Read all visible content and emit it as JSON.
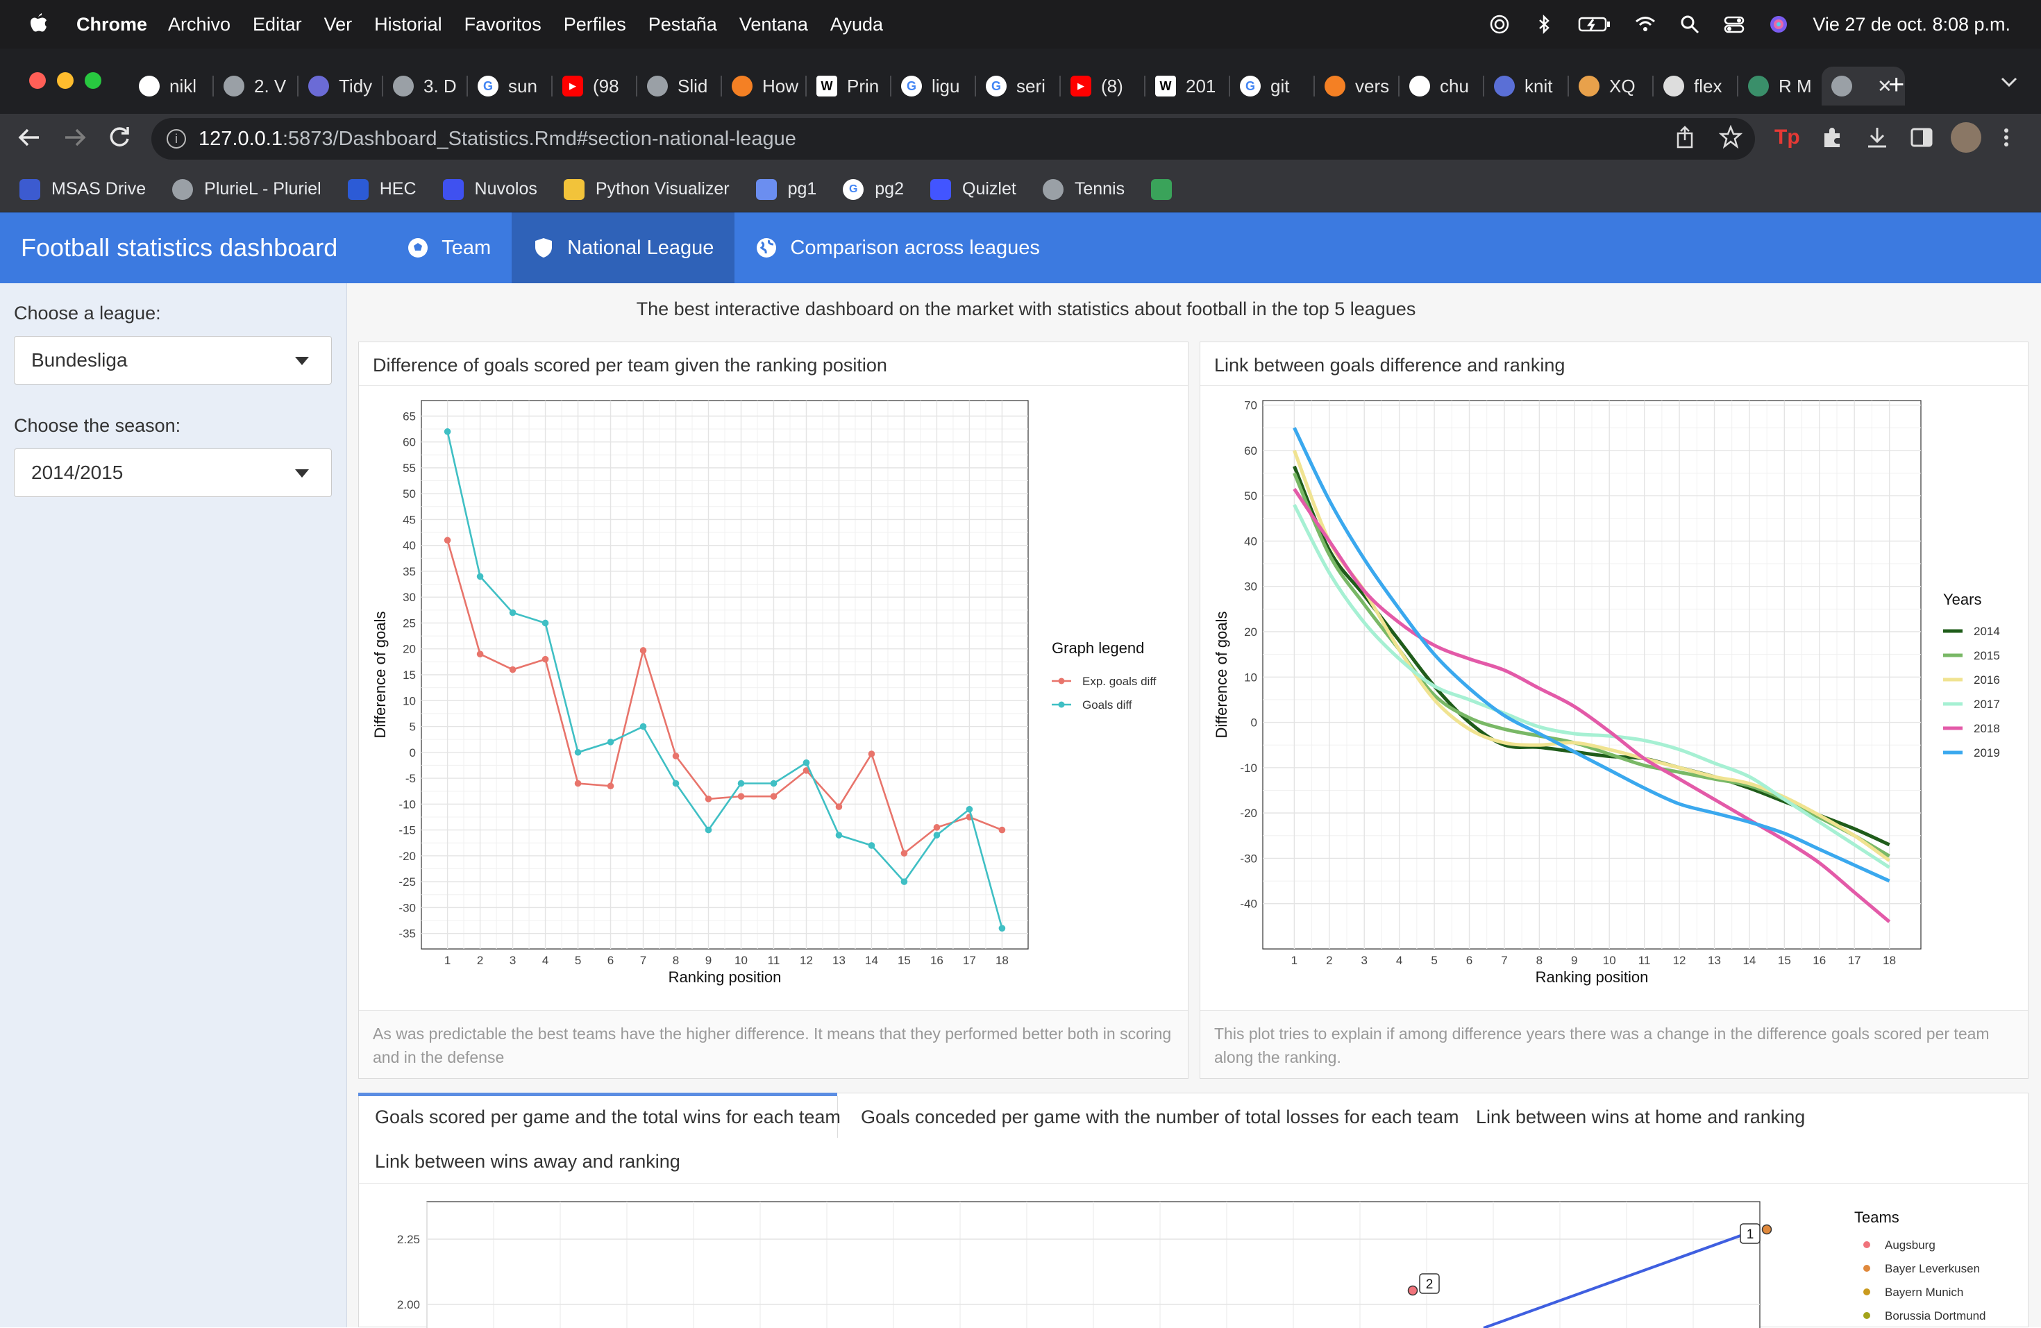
{
  "menubar": {
    "app": "Chrome",
    "items": [
      "Archivo",
      "Editar",
      "Ver",
      "Historial",
      "Favoritos",
      "Perfiles",
      "Pestaña",
      "Ventana",
      "Ayuda"
    ],
    "clock": "Vie 27 de oct.  8:08 p.m."
  },
  "tabs": [
    {
      "label": "nikl",
      "icon": "github-icon",
      "color": "#ffffff"
    },
    {
      "label": "2. V",
      "icon": "globe-icon",
      "color": "#9aa0a6"
    },
    {
      "label": "Tidy",
      "icon": "site-icon",
      "color": "#6b6bd6"
    },
    {
      "label": "3. D",
      "icon": "globe-icon",
      "color": "#9aa0a6"
    },
    {
      "label": "sun",
      "icon": "google-icon",
      "color": "#4285f4"
    },
    {
      "label": "(98",
      "icon": "youtube-icon",
      "color": "#ff0000"
    },
    {
      "label": "Slid",
      "icon": "globe-icon",
      "color": "#9aa0a6"
    },
    {
      "label": "How",
      "icon": "stackoverflow-icon",
      "color": "#f48024"
    },
    {
      "label": "Prin",
      "icon": "wikipedia-icon",
      "color": "#ffffff"
    },
    {
      "label": "ligu",
      "icon": "google-icon",
      "color": "#4285f4"
    },
    {
      "label": "seri",
      "icon": "google-icon",
      "color": "#4285f4"
    },
    {
      "label": "(8)",
      "icon": "youtube-icon",
      "color": "#ff0000"
    },
    {
      "label": "201",
      "icon": "wikipedia-icon",
      "color": "#ffffff"
    },
    {
      "label": "git",
      "icon": "google-icon",
      "color": "#4285f4"
    },
    {
      "label": "vers",
      "icon": "stackoverflow-icon",
      "color": "#f48024"
    },
    {
      "label": "chu",
      "icon": "github-icon",
      "color": "#ffffff"
    },
    {
      "label": "knit",
      "icon": "site-icon",
      "color": "#5a6fd6"
    },
    {
      "label": "XQ",
      "icon": "site-icon",
      "color": "#e8a14b"
    },
    {
      "label": "flex",
      "icon": "site-icon",
      "color": "#dddddd"
    },
    {
      "label": "R M",
      "icon": "site-icon",
      "color": "#3a8f6a"
    },
    {
      "label": "",
      "icon": "globe-icon",
      "color": "#9aa0a6",
      "active": true
    }
  ],
  "address": {
    "host": "127.0.0.1",
    "path": ":5873/Dashboard_Statistics.Rmd#section-national-league"
  },
  "bookmarks": [
    {
      "label": "MSAS Drive",
      "icon": "drive-icon",
      "color": "#3c5bd0"
    },
    {
      "label": "PlurieL - Pluriel",
      "icon": "globe-icon",
      "color": "#9aa0a6"
    },
    {
      "label": "HEC",
      "icon": "unil-icon",
      "color": "#2c5bd6"
    },
    {
      "label": "Nuvolos",
      "icon": "nuvolos-icon",
      "color": "#3f51f0"
    },
    {
      "label": "Python Visualizer",
      "icon": "python-icon",
      "color": "#f2c33a"
    },
    {
      "label": "pg1",
      "icon": "site-icon",
      "color": "#6b8ef0"
    },
    {
      "label": "pg2",
      "icon": "google-icon",
      "color": "#4285f4"
    },
    {
      "label": "Quizlet",
      "icon": "quizlet-icon",
      "color": "#4255ff"
    },
    {
      "label": "Tennis",
      "icon": "globe-icon",
      "color": "#9aa0a6"
    },
    {
      "label": "",
      "icon": "site-icon",
      "color": "#3aa35a"
    }
  ],
  "navbar": {
    "brand": "Football statistics dashboard",
    "items": [
      {
        "label": "Team",
        "icon": "soccer-ball-icon"
      },
      {
        "label": "National League",
        "icon": "shield-icon",
        "active": true
      },
      {
        "label": "Comparison across leagues",
        "icon": "globe-icon"
      }
    ]
  },
  "sidebar": {
    "league_label": "Choose a league:",
    "league_value": "Bundesliga",
    "season_label": "Choose the season:",
    "season_value": "2014/2015"
  },
  "headline": "The best interactive dashboard on the market with statistics about football in the top 5 leagues",
  "card1": {
    "title": "Difference of goals scored per team given the ranking position",
    "footer": "As was predictable the best teams have the higher difference. It means that they performed better both in scoring and in the defense"
  },
  "card2": {
    "title": "Link between goals difference and ranking",
    "footer": "This plot tries to explain if among difference years there was a change in the difference goals scored per team along the ranking."
  },
  "tabset": [
    {
      "label": "Goals scored per game and the total wins for each team",
      "active": true
    },
    {
      "label": "Goals conceded per game with the number of total losses for each team"
    },
    {
      "label": "Link between wins at home and ranking"
    },
    {
      "label": "Link between wins away and ranking"
    }
  ],
  "colors": {
    "navbar": "#3c7ae0",
    "navbar_active": "#2f62b8",
    "exp_goals": "#e8746b",
    "goals": "#3fbfc4"
  },
  "chart_data": [
    {
      "type": "line",
      "xlabel": "Ranking position",
      "ylabel": "Difference of goals",
      "legend_title": "Graph legend",
      "legend_position": "right",
      "grid": true,
      "x": [
        1,
        2,
        3,
        4,
        5,
        6,
        7,
        8,
        9,
        10,
        11,
        12,
        13,
        14,
        15,
        16,
        17,
        18
      ],
      "xlim": [
        0.2,
        18.8
      ],
      "ylim": [
        -38,
        68
      ],
      "yticks": [
        65,
        60,
        55,
        50,
        45,
        40,
        35,
        30,
        25,
        20,
        15,
        10,
        5,
        0,
        -5,
        -10,
        -15,
        -20,
        -25,
        -30,
        -35
      ],
      "series": [
        {
          "name": "Exp. goals diff",
          "color": "#e8746b",
          "values": [
            41,
            19,
            16,
            18,
            -6,
            -6.5,
            19.7,
            -0.7,
            -9,
            -8.5,
            -8.5,
            -3.5,
            -10.5,
            -0.3,
            -19.5,
            -14.5,
            -12.5,
            -15
          ]
        },
        {
          "name": "Goals diff",
          "color": "#3fbfc4",
          "values": [
            62,
            34,
            27,
            25,
            0,
            2,
            5,
            -6,
            -15,
            -6,
            -6,
            -2,
            -16,
            -18,
            -25,
            -16,
            -11,
            -34
          ]
        }
      ]
    },
    {
      "type": "line",
      "xlabel": "Ranking position",
      "ylabel": "Difference of goals",
      "legend_title": "Years",
      "legend_position": "right",
      "grid": true,
      "x": [
        1,
        2,
        3,
        4,
        5,
        6,
        7,
        8,
        9,
        10,
        11,
        12,
        13,
        14,
        15,
        16,
        17,
        18
      ],
      "xlim": [
        0.1,
        18.9
      ],
      "ylim": [
        -50,
        71
      ],
      "yticks": [
        70,
        60,
        50,
        40,
        30,
        20,
        10,
        0,
        -10,
        -20,
        -30,
        -40
      ],
      "series": [
        {
          "name": "2014",
          "color": "#1f5c1a",
          "values": [
            56.5,
            38,
            28,
            18,
            8,
            0,
            -5,
            -5.5,
            -6.5,
            -7.5,
            -8,
            -10,
            -12,
            -14.5,
            -17.5,
            -20.5,
            -23.5,
            -27
          ]
        },
        {
          "name": "2015",
          "color": "#79b866",
          "values": [
            55,
            37,
            26,
            16,
            6,
            1,
            -1.5,
            -3,
            -4.5,
            -7,
            -9.5,
            -11,
            -12.5,
            -14,
            -17,
            -21,
            -25,
            -29.5
          ]
        },
        {
          "name": "2016",
          "color": "#f0e391",
          "values": [
            60,
            40,
            29,
            16,
            5,
            -1.5,
            -4.5,
            -5,
            -4.5,
            -6,
            -8,
            -10,
            -12,
            -13.5,
            -16.5,
            -20.5,
            -25,
            -30.5
          ]
        },
        {
          "name": "2017",
          "color": "#a6f0d3",
          "values": [
            48,
            33,
            22,
            14,
            8,
            5,
            2,
            -1,
            -2.5,
            -3,
            -4,
            -6,
            -9,
            -12,
            -17,
            -22,
            -27,
            -32
          ]
        },
        {
          "name": "2018",
          "color": "#e35aa8",
          "values": [
            51.5,
            40,
            29,
            22,
            17,
            14,
            11.5,
            7.5,
            3.5,
            -2,
            -8,
            -12.5,
            -17,
            -21.5,
            -26,
            -31,
            -37.5,
            -44
          ]
        },
        {
          "name": "2019",
          "color": "#3aa8ee",
          "values": [
            65,
            49,
            36,
            25,
            15,
            7.5,
            1.5,
            -2.5,
            -6.5,
            -10.5,
            -14.5,
            -18,
            -20,
            -22,
            -24.5,
            -28,
            -31.5,
            -35
          ]
        }
      ]
    },
    {
      "type": "scatter",
      "legend_title": "Teams",
      "legend_position": "right",
      "grid": true,
      "yticks": [
        2.25,
        2.0
      ],
      "legend": [
        {
          "name": "Augsburg",
          "color": "#f0737b"
        },
        {
          "name": "Bayer Leverkusen",
          "color": "#e0893c"
        },
        {
          "name": "Bayern Munich",
          "color": "#c99a1e"
        },
        {
          "name": "Borussia Dortmund",
          "color": "#a3a31a"
        }
      ],
      "labels": [
        "1",
        "2"
      ]
    }
  ]
}
